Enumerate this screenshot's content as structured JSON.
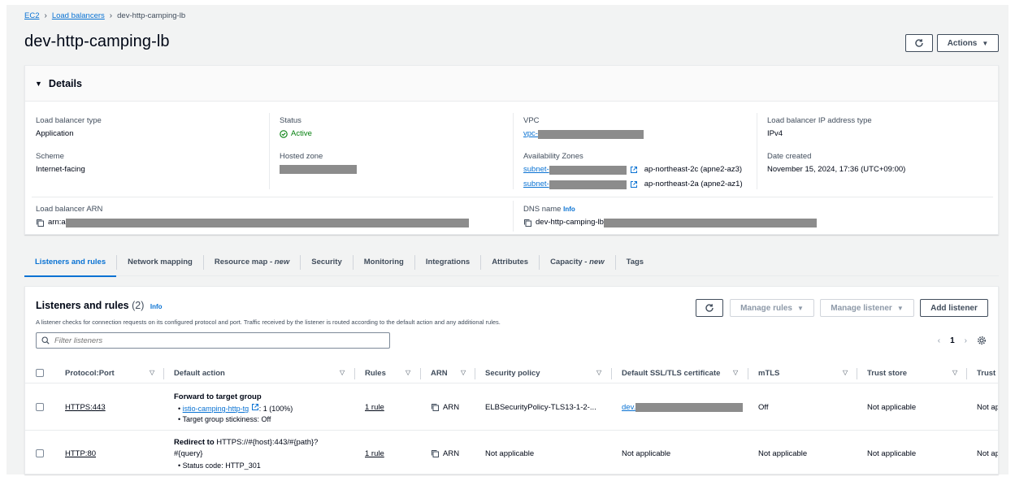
{
  "breadcrumb": {
    "root": "EC2",
    "parent": "Load balancers",
    "current": "dev-http-camping-lb"
  },
  "page_title": "dev-http-camping-lb",
  "header_actions": {
    "actions_label": "Actions"
  },
  "details": {
    "heading": "Details",
    "lb_type_label": "Load balancer type",
    "lb_type_value": "Application",
    "status_label": "Status",
    "status_value": "Active",
    "vpc_label": "VPC",
    "vpc_value": "vpc-",
    "ip_type_label": "Load balancer IP address type",
    "ip_type_value": "IPv4",
    "scheme_label": "Scheme",
    "scheme_value": "Internet-facing",
    "hosted_zone_label": "Hosted zone",
    "az_label": "Availability Zones",
    "az": [
      {
        "subnet": "subnet-",
        "zone": "ap-northeast-2c (apne2-az3)"
      },
      {
        "subnet": "subnet-",
        "zone": "ap-northeast-2a (apne2-az1)"
      }
    ],
    "date_label": "Date created",
    "date_value": "November 15, 2024, 17:36 (UTC+09:00)",
    "arn_label": "Load balancer ARN",
    "arn_value": "arn:a",
    "dns_label": "DNS name",
    "dns_info": "Info",
    "dns_value": "dev-http-camping-lb"
  },
  "tabs": [
    {
      "label": "Listeners and rules",
      "suffix": ""
    },
    {
      "label": "Network mapping",
      "suffix": ""
    },
    {
      "label": "Resource map - ",
      "suffix": "new"
    },
    {
      "label": "Security",
      "suffix": ""
    },
    {
      "label": "Monitoring",
      "suffix": ""
    },
    {
      "label": "Integrations",
      "suffix": ""
    },
    {
      "label": "Attributes",
      "suffix": ""
    },
    {
      "label": "Capacity - ",
      "suffix": "new"
    },
    {
      "label": "Tags",
      "suffix": ""
    }
  ],
  "listeners": {
    "title": "Listeners and rules",
    "count": "(2)",
    "info": "Info",
    "description": "A listener checks for connection requests on its configured protocol and port. Traffic received by the listener is routed according to the default action and any additional rules.",
    "manage_rules": "Manage rules",
    "manage_listener": "Manage listener",
    "add_listener": "Add listener",
    "filter_placeholder": "Filter listeners",
    "page": "1",
    "columns": [
      "Protocol:Port",
      "Default action",
      "Rules",
      "ARN",
      "Security policy",
      "Default SSL/TLS certificate",
      "mTLS",
      "Trust store",
      "Trust s"
    ],
    "rows": [
      {
        "protocol": "HTTPS:443",
        "action_title": "Forward to target group",
        "action_target": "istio-camping-http-tg",
        "action_weight": ": 1 (100%)",
        "action_extra": "Target group stickiness: Off",
        "rules": "1 rule",
        "arn": "ARN",
        "policy": "ELBSecurityPolicy-TLS13-1-2-...",
        "cert": "dev.",
        "mtls": "Off",
        "trust_store": "Not applicable",
        "trust_s": "Not ap"
      },
      {
        "protocol": "HTTP:80",
        "action_title": "Redirect to",
        "action_target": " HTTPS://#{host}:443/#{path}?",
        "action_line2": "#{query}",
        "action_extra": "Status code: HTTP_301",
        "rules": "1 rule",
        "arn": "ARN",
        "policy": "Not applicable",
        "cert": "Not applicable",
        "mtls": "Not applicable",
        "trust_store": "Not applicable",
        "trust_s": "Not ap"
      }
    ]
  }
}
